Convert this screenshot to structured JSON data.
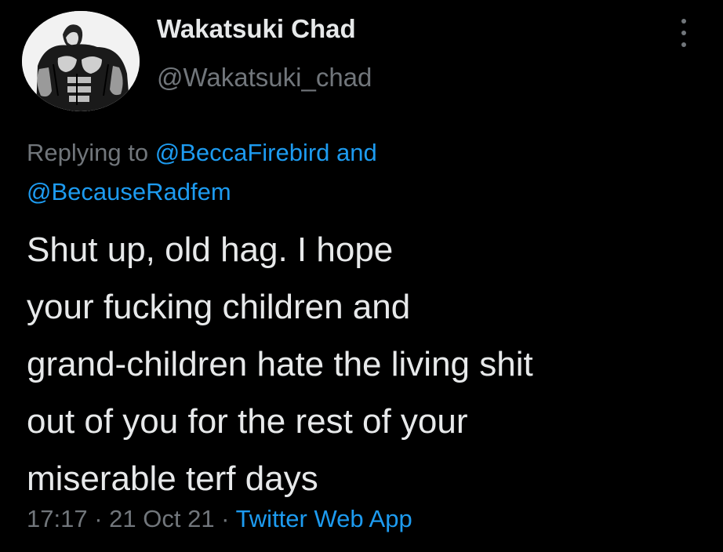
{
  "author": {
    "display_name": "Wakatsuki Chad",
    "handle": "@Wakatsuki_chad"
  },
  "reply_context": {
    "prefix": "Replying to ",
    "mention_1": "@BeccaFirebird",
    "conjunction": " and",
    "mention_2": "@BecauseRadfem"
  },
  "tweet": {
    "text": "Shut up, old hag. I hope\nyour fucking children and\ngrand-children hate the living shit\nout of you for the rest of your\nmiserable terf days"
  },
  "meta": {
    "time": "17:17",
    "separator": " · ",
    "date": "21 Oct 21",
    "separator2": " · ",
    "source": "Twitter Web App"
  },
  "icons": {
    "more": "more-options-icon",
    "avatar": "muscular-man-avatar"
  },
  "colors": {
    "background": "#000000",
    "primary_text": "#e7e9ea",
    "secondary_text": "#71767b",
    "link": "#1d9bf0"
  }
}
